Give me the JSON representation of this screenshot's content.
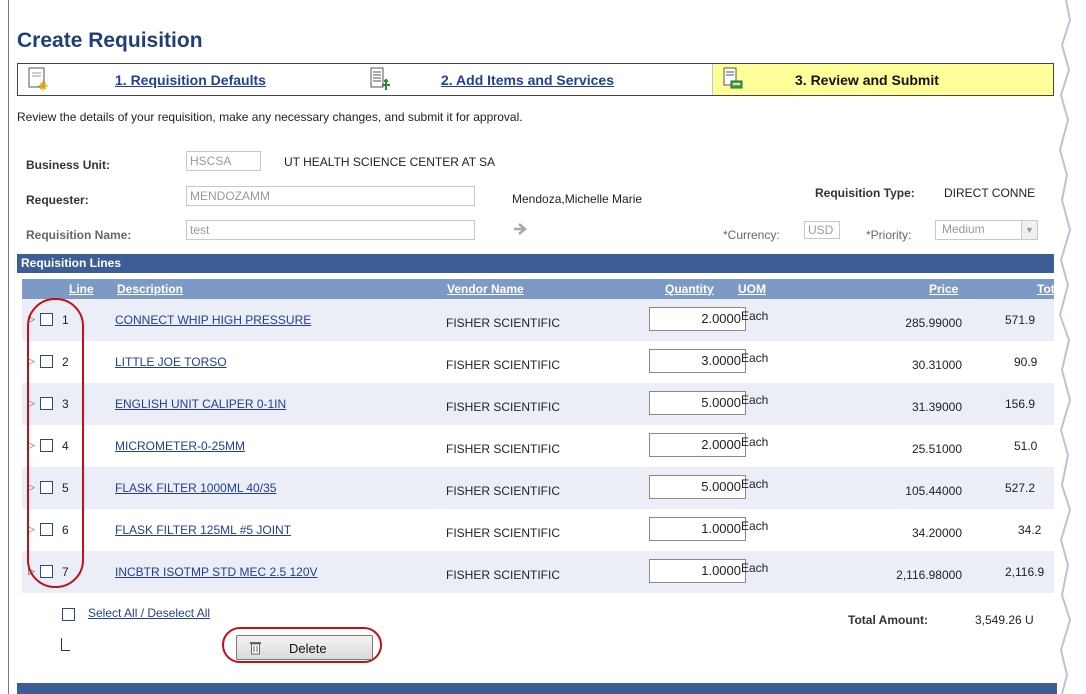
{
  "page": {
    "title": "Create Requisition"
  },
  "steps": [
    {
      "label": "1. Requisition Defaults",
      "icon": "requisition-defaults-icon"
    },
    {
      "label": "2. Add Items and Services",
      "icon": "add-items-icon"
    },
    {
      "label": "3. Review and Submit",
      "icon": "review-submit-icon",
      "active": true
    }
  ],
  "instructions": "Review the details of your requisition, make any necessary changes, and submit it for approval.",
  "header": {
    "business_unit_label": "Business Unit:",
    "business_unit_value": "HSCSA",
    "business_unit_desc": "UT HEALTH SCIENCE CENTER AT SA",
    "requester_label": "Requester:",
    "requester_value": "MENDOZAMM",
    "requester_name": "Mendoza,Michelle Marie",
    "requisition_type_label": "Requisition Type:",
    "requisition_type_value": "DIRECT CONNE",
    "requisition_name_label": "Requisition Name:",
    "requisition_name_value": "test",
    "currency_label": "*Currency:",
    "currency_value": "USD",
    "priority_label": "*Priority:",
    "priority_value": "Medium"
  },
  "lines_section": {
    "title": "Requisition Lines",
    "columns": {
      "line": "Line",
      "description": "Description",
      "vendor": "Vendor Name",
      "quantity": "Quantity",
      "uom": "UOM",
      "price": "Price",
      "total": "Tota"
    },
    "rows": [
      {
        "line": "1",
        "description": "CONNECT WHIP HIGH PRESSURE",
        "vendor": "FISHER SCIENTIFIC",
        "quantity": "2.0000",
        "uom": "Each",
        "price": "285.99000",
        "total": "571.9"
      },
      {
        "line": "2",
        "description": "LITTLE JOE TORSO",
        "vendor": "FISHER SCIENTIFIC",
        "quantity": "3.0000",
        "uom": "Each",
        "price": "30.31000",
        "total": "90.9"
      },
      {
        "line": "3",
        "description": "ENGLISH UNIT CALIPER 0-1IN",
        "vendor": "FISHER SCIENTIFIC",
        "quantity": "5.0000",
        "uom": "Each",
        "price": "31.39000",
        "total": "156.9"
      },
      {
        "line": "4",
        "description": "MICROMETER-0-25MM",
        "vendor": "FISHER SCIENTIFIC",
        "quantity": "2.0000",
        "uom": "Each",
        "price": "25.51000",
        "total": "51.0"
      },
      {
        "line": "5",
        "description": "FLASK FILTER 1000ML 40/35",
        "vendor": "FISHER SCIENTIFIC",
        "quantity": "5.0000",
        "uom": "Each",
        "price": "105.44000",
        "total": "527.2"
      },
      {
        "line": "6",
        "description": "FLASK FILTER 125ML #5 JOINT",
        "vendor": "FISHER SCIENTIFIC",
        "quantity": "1.0000",
        "uom": "Each",
        "price": "34.20000",
        "total": "34.2"
      },
      {
        "line": "7",
        "description": "INCBTR ISOTMP STD MEC 2.5 120V",
        "vendor": "FISHER SCIENTIFIC",
        "quantity": "1.0000",
        "uom": "Each",
        "price": "2,116.98000",
        "total": "2,116.9"
      }
    ],
    "select_all": "Select All / Deselect All",
    "total_label": "Total Amount:",
    "total_value": "3,549.26 U",
    "delete_label": "Delete"
  },
  "colors": {
    "header_bar": "#3c5d95",
    "column_bar": "#7d9ac7",
    "active_step": "#ffff99",
    "link": "#1f3f9a",
    "highlight": "#c0101a"
  }
}
